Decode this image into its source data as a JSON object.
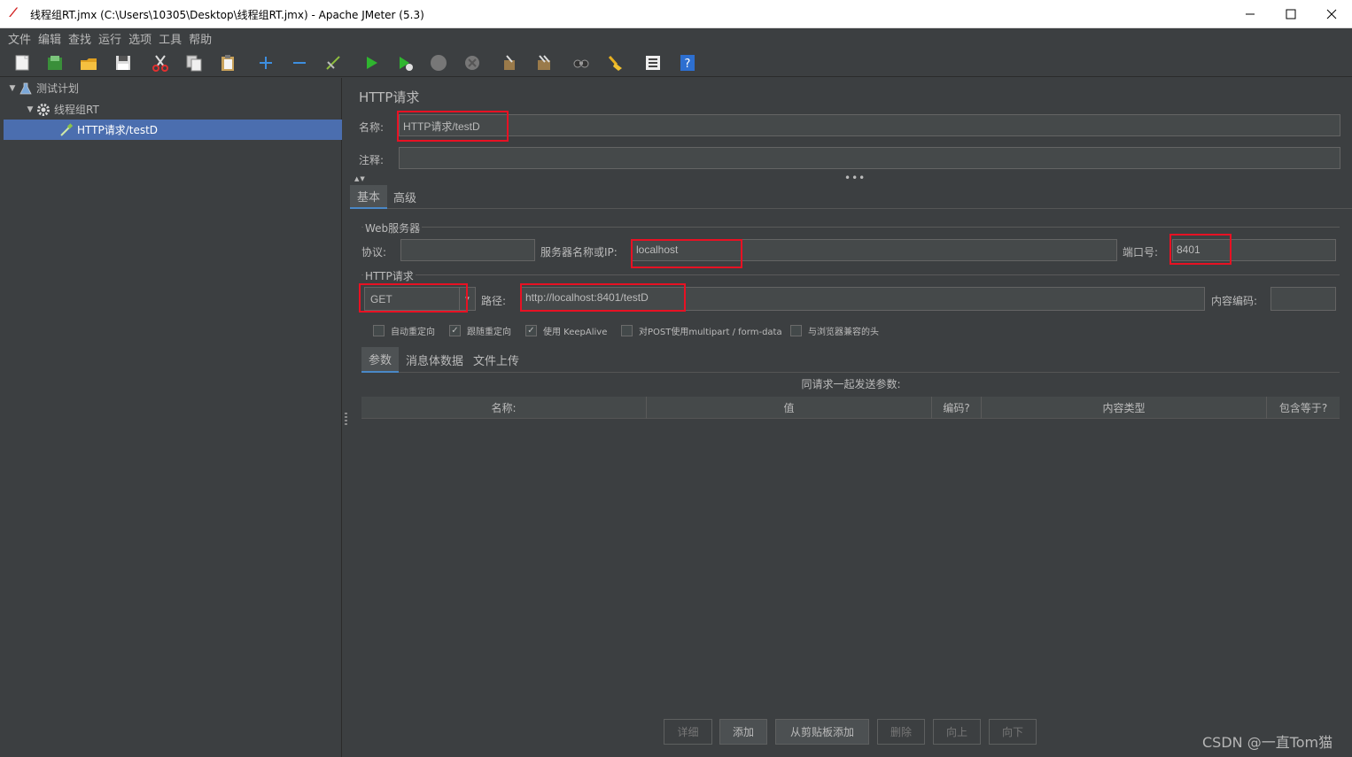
{
  "window": {
    "title": "线程组RT.jmx (C:\\Users\\10305\\Desktop\\线程组RT.jmx) - Apache JMeter (5.3)",
    "minimize": "—",
    "maximize": "☐",
    "close": "✕"
  },
  "menu": [
    "文件",
    "编辑",
    "查找",
    "运行",
    "选项",
    "工具",
    "帮助"
  ],
  "toolbar": [
    {
      "name": "new-icon"
    },
    {
      "name": "templates-icon"
    },
    {
      "name": "open-icon"
    },
    {
      "name": "save-icon"
    },
    {
      "name": "cut-icon"
    },
    {
      "name": "copy-icon"
    },
    {
      "name": "paste-icon"
    },
    {
      "name": "expand-icon"
    },
    {
      "name": "collapse-icon"
    },
    {
      "name": "toggle-icon"
    },
    {
      "name": "start-icon"
    },
    {
      "name": "start-no-pause-icon"
    },
    {
      "name": "stop-icon"
    },
    {
      "name": "shutdown-icon"
    },
    {
      "name": "clear-icon"
    },
    {
      "name": "clear-all-icon"
    },
    {
      "name": "search-icon"
    },
    {
      "name": "reset-search-icon"
    },
    {
      "name": "function-helper-icon"
    },
    {
      "name": "help-icon"
    }
  ],
  "tree": {
    "items": [
      {
        "label": "测试计划",
        "level": 0
      },
      {
        "label": "线程组RT",
        "level": 1
      },
      {
        "label": "HTTP请求/testD",
        "level": 2,
        "selected": true
      }
    ]
  },
  "panel": {
    "title": "HTTP请求",
    "name_label": "名称:",
    "name_value": "HTTP请求/testD",
    "comment_label": "注释:",
    "comment_value": "",
    "tabs": [
      "基本",
      "高级"
    ],
    "web_server": {
      "title": "Web服务器",
      "protocol_label": "协议:",
      "protocol_value": "",
      "server_label": "服务器名称或IP:",
      "server_value": "localhost",
      "port_label": "端口号:",
      "port_value": "8401"
    },
    "http_request": {
      "title": "HTTP请求",
      "method": "GET",
      "path_label": "路径:",
      "path_value": "http://localhost:8401/testD",
      "encoding_label": "内容编码:",
      "encoding_value": ""
    },
    "checkboxes": [
      {
        "label": "自动重定向",
        "checked": false
      },
      {
        "label": "跟随重定向",
        "checked": true
      },
      {
        "label": "使用 KeepAlive",
        "checked": true
      },
      {
        "label": "对POST使用multipart / form-data",
        "checked": false
      },
      {
        "label": "与浏览器兼容的头",
        "checked": false
      }
    ],
    "subtabs": [
      "参数",
      "消息体数据",
      "文件上传"
    ],
    "params_caption": "同请求一起发送参数:",
    "columns": [
      "名称:",
      "值",
      "编码?",
      "内容类型",
      "包含等于?"
    ],
    "buttons": [
      {
        "label": "详细",
        "enabled": false
      },
      {
        "label": "添加",
        "enabled": true
      },
      {
        "label": "从剪贴板添加",
        "enabled": true
      },
      {
        "label": "删除",
        "enabled": false
      },
      {
        "label": "向上",
        "enabled": false
      },
      {
        "label": "向下",
        "enabled": false
      }
    ]
  },
  "watermark": "CSDN @一直Tom猫",
  "colors": {
    "background": "#3c3f41",
    "selection": "#4b6eaf",
    "highlight": "#e81123"
  }
}
